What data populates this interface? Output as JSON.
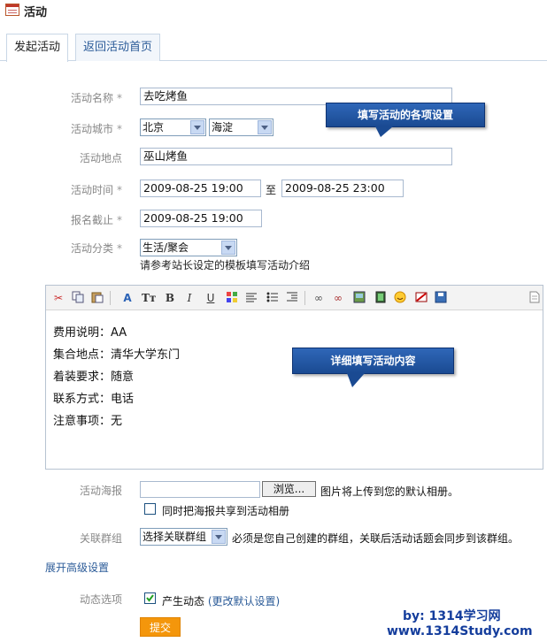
{
  "header": {
    "title": "活动"
  },
  "tabs": [
    {
      "label": "发起活动",
      "active": true
    },
    {
      "label": "返回活动首页",
      "active": false
    }
  ],
  "form": {
    "name": {
      "label": "活动名称",
      "required": "*",
      "value": "去吃烤鱼"
    },
    "city": {
      "label": "活动城市",
      "required": "*",
      "province": "北京",
      "district": "海淀"
    },
    "place": {
      "label": "活动地点",
      "value": "巫山烤鱼"
    },
    "time": {
      "label": "活动时间",
      "required": "*",
      "start": "2009-08-25 19:00",
      "sep": "至",
      "end": "2009-08-25 23:00"
    },
    "deadline": {
      "label": "报名截止",
      "required": "*",
      "value": "2009-08-25 19:00"
    },
    "category": {
      "label": "活动分类",
      "required": "*",
      "value": "生活/聚会",
      "hint": "请参考站长设定的模板填写活动介绍"
    }
  },
  "callouts": {
    "top": "填写活动的各项设置",
    "editor": "详细填写活动内容"
  },
  "editor": {
    "toolbar": [
      "cut-icon",
      "copy-icon",
      "paste-icon",
      "find-replace-icon",
      "font-size-icon",
      "bold-icon",
      "italic-icon",
      "underline-icon",
      "text-color-icon",
      "align-icon",
      "list-icon",
      "indent-icon",
      "link-icon",
      "unlink-icon",
      "image-icon",
      "video-icon",
      "smiley-icon",
      "clear-format-icon",
      "save-icon",
      "source-icon"
    ],
    "lines": [
      "费用说明：AA",
      "集合地点：清华大学东门",
      "着装要求：随意",
      "联系方式：电话",
      "注意事项：无"
    ]
  },
  "poster": {
    "label": "活动海报",
    "browse": "浏览...",
    "note": "图片将上传到您的默认相册。",
    "share": "同时把海报共享到活动相册"
  },
  "group": {
    "label": "关联群组",
    "select": "选择关联群组",
    "note": "必须是您自己创建的群组，关联后活动话题会同步到该群组。"
  },
  "advanced": "展开高级设置",
  "feed": {
    "label": "动态选项",
    "option": "产生动态",
    "change": "(更改默认设置)"
  },
  "submit": "提交",
  "watermark": {
    "line1": "by: 1314学习网",
    "line2": "www.1314Study.com"
  },
  "colors": {
    "accent": "#2b5b98",
    "submit": "#f4960b",
    "callout": "#2f67b8"
  }
}
